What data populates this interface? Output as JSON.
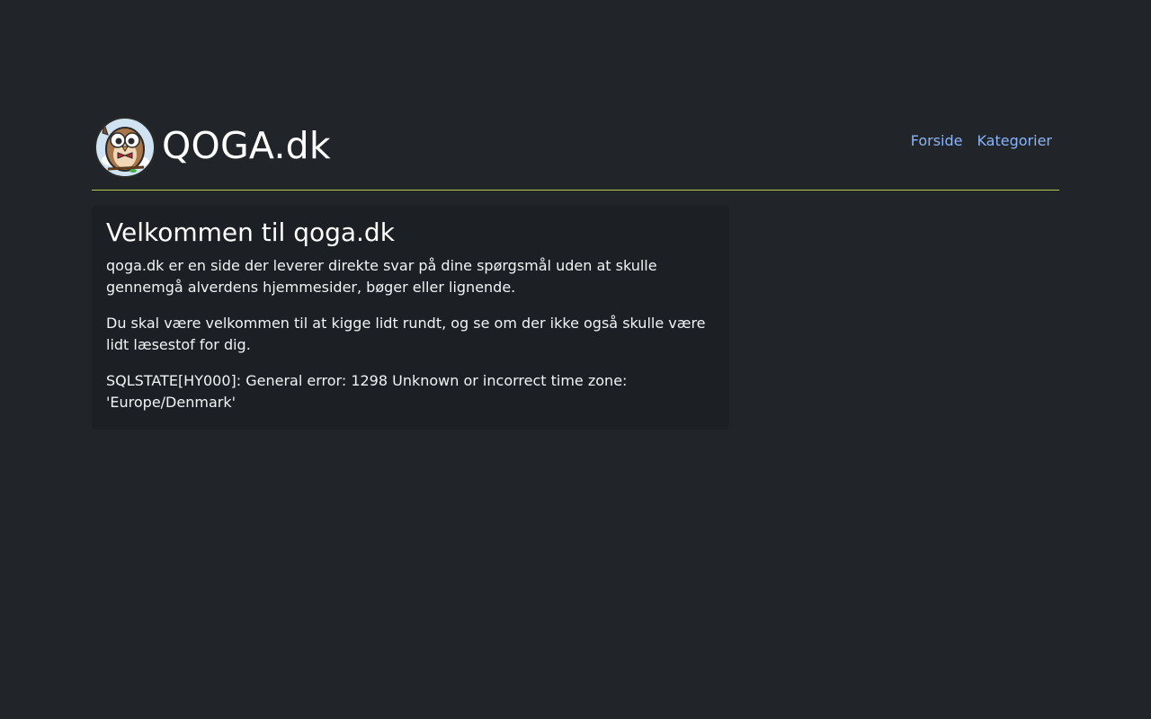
{
  "header": {
    "brand": "QOGA.dk",
    "logo_icon": "owl-logo-icon",
    "nav": [
      {
        "label": "Forside"
      },
      {
        "label": "Kategorier"
      }
    ]
  },
  "main": {
    "title": "Velkommen til qoga.dk",
    "paragraphs": [
      "qoga.dk er en side der leverer direkte svar på dine spørgsmål uden at skulle gennemgå alverdens hjemmesider, bøger eller lignende.",
      "Du skal være velkommen til at kigge lidt rundt, og se om der ikke også skulle være lidt læsestof for dig.",
      "SQLSTATE[HY000]: General error: 1298 Unknown or incorrect time zone: 'Europe/Denmark'"
    ]
  },
  "colors": {
    "background": "#212529",
    "card": "#1c1f23",
    "link": "#8ab4f8",
    "divider": "#b5c94a"
  }
}
